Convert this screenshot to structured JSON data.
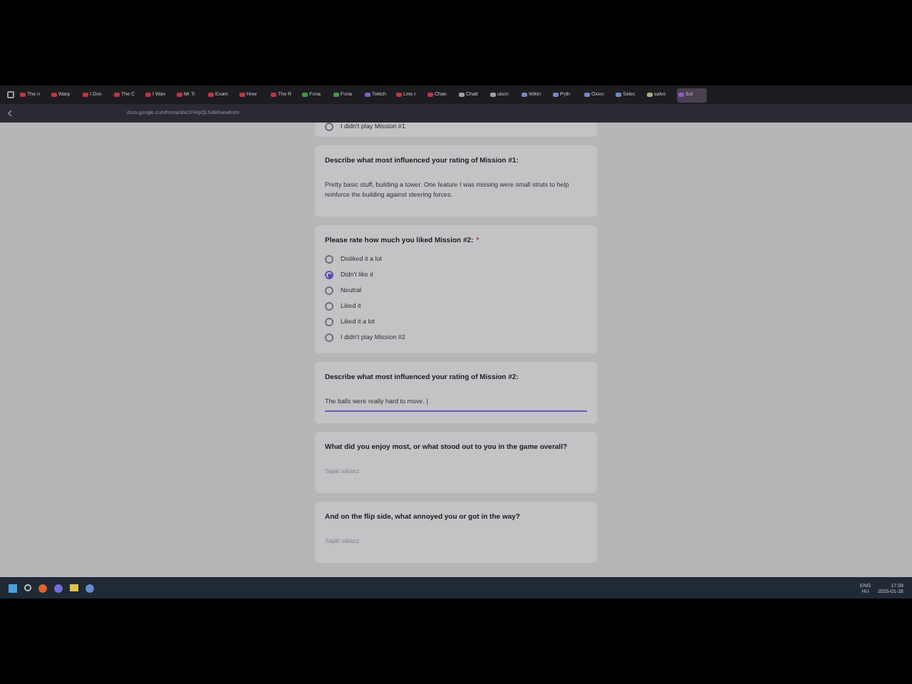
{
  "browser": {
    "tabs": [
      {
        "label": "The n",
        "color": "#c8323c",
        "selected": false
      },
      {
        "label": "Warp",
        "color": "#c8323c",
        "selected": false
      },
      {
        "label": "I Don",
        "color": "#c8323c",
        "selected": false
      },
      {
        "label": "The C",
        "color": "#c8323c",
        "selected": false
      },
      {
        "label": "I Wan",
        "color": "#c8323c",
        "selected": false
      },
      {
        "label": "Mr Ti",
        "color": "#c8323c",
        "selected": false
      },
      {
        "label": "Exam",
        "color": "#c8323c",
        "selected": false
      },
      {
        "label": "How",
        "color": "#c8323c",
        "selected": false
      },
      {
        "label": "The R",
        "color": "#c8323c",
        "selected": false
      },
      {
        "label": "Fona",
        "color": "#3a9a4a",
        "selected": false
      },
      {
        "label": "Fona",
        "color": "#3a9a4a",
        "selected": false
      },
      {
        "label": "Twitch",
        "color": "#8a5ad0",
        "selected": false
      },
      {
        "label": "Line r",
        "color": "#c8323c",
        "selected": false
      },
      {
        "label": "Chan",
        "color": "#c8323c",
        "selected": false
      },
      {
        "label": "Chatt",
        "color": "#9aa0a8",
        "selected": false
      },
      {
        "label": "ubon",
        "color": "#9aa0a8",
        "selected": false
      },
      {
        "label": "Wikin",
        "color": "#6a8ac8",
        "selected": false
      },
      {
        "label": "Pyth",
        "color": "#6a8ac8",
        "selected": false
      },
      {
        "label": "Oxivo",
        "color": "#6a8ac8",
        "selected": false
      },
      {
        "label": "Selec",
        "color": "#6a8ac8",
        "selected": false
      },
      {
        "label": "salvo",
        "color": "#a0b080",
        "selected": false
      },
      {
        "label": "Sol",
        "color": "#8a5ad0",
        "selected": true
      }
    ],
    "url": "docs.google.com/forms/d/e/1FAIpQLSdM/viewform"
  },
  "form": [
    {
      "kind": "choice",
      "options": [
        {
          "label": "I didn't play Mission #1",
          "selected": false
        }
      ]
    },
    {
      "kind": "text",
      "question": "Describe what most influenced your rating of Mission #1:",
      "value": "Pretty basic stuff, building a tower. One feature I was missing were small struts to help reinforce the building against steering forces.",
      "focused": false
    },
    {
      "kind": "choice",
      "question": "Please rate how much you liked Mission #2:",
      "required_mark": "*",
      "options": [
        {
          "label": "Disliked it a lot",
          "selected": false
        },
        {
          "label": "Didn't like it",
          "selected": true
        },
        {
          "label": "Neutral",
          "selected": false
        },
        {
          "label": "Liked it",
          "selected": false
        },
        {
          "label": "Liked it a lot",
          "selected": false
        },
        {
          "label": "I didn't play Mission #2",
          "selected": false
        }
      ]
    },
    {
      "kind": "text",
      "question": "Describe what most influenced your rating of Mission #2:",
      "value": "The balls were really hard to move. |",
      "focused": true
    },
    {
      "kind": "text",
      "question": "What did you enjoy most, or what stood out to you in the game overall?",
      "placeholder": "Saját válasz",
      "focused": false
    },
    {
      "kind": "text",
      "question": "And on the flip side, what annoyed you or got in the way?",
      "placeholder": "Saját válasz",
      "focused": false
    }
  ],
  "taskbar": {
    "language": "ENG",
    "layout": "HU",
    "time": "17:09",
    "date": "2025-01-28"
  }
}
